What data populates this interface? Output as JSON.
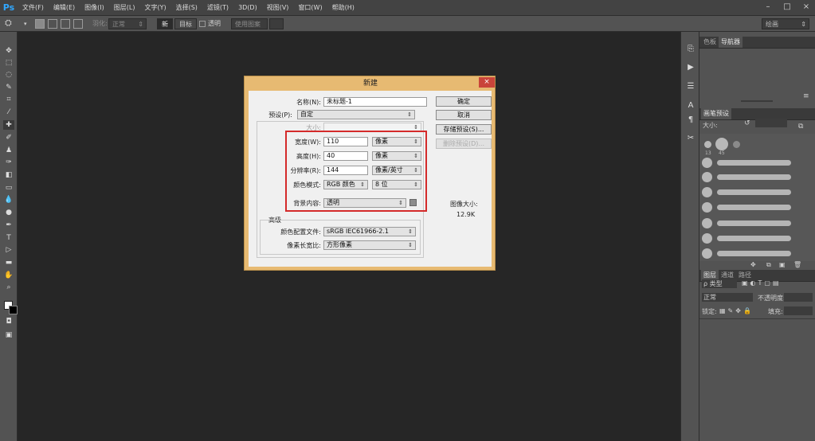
{
  "app": {
    "logo": "Ps"
  },
  "menu": [
    "文件(F)",
    "编辑(E)",
    "图像(I)",
    "图层(L)",
    "文字(Y)",
    "选择(S)",
    "滤镜(T)",
    "3D(D)",
    "视图(V)",
    "窗口(W)",
    "帮助(H)"
  ],
  "window_controls": {
    "minimize": "–",
    "restore": "□",
    "close": "×"
  },
  "options_bar": {
    "feather_label": "羽化:",
    "mode_label": "正常",
    "btn_new": "新",
    "btn_target": "目标",
    "transparent_label": "透明",
    "use_pattern": "使用图案",
    "workspace": "绘画"
  },
  "tools": [
    "move-icon",
    "marquee-icon",
    "lasso-icon",
    "quick-select-icon",
    "crop-icon",
    "eyedropper-icon",
    "healing-icon",
    "brush-icon",
    "stamp-icon",
    "history-brush-icon",
    "eraser-icon",
    "gradient-icon",
    "blur-icon",
    "dodge-icon",
    "pen-icon",
    "type-icon",
    "path-select-icon",
    "shape-icon",
    "hand-icon",
    "zoom-icon"
  ],
  "panels": {
    "top_tabs": [
      "色板",
      "导航器"
    ],
    "brush_presets_tab": "画笔预设",
    "brush_size_label": "大小:",
    "brush_sizes": [
      "13",
      "45"
    ],
    "layers_tabs": [
      "图层",
      "通道",
      "路径"
    ],
    "kind_label": "ρ 类型",
    "blend_mode": "正常",
    "opacity_label": "不透明度:",
    "lock_label": "锁定:",
    "fill_label": "填充:"
  },
  "dialog": {
    "title": "新建",
    "close": "×",
    "name_label": "名称(N):",
    "name_value": "未标题-1",
    "preset_label": "预设(P):",
    "preset_value": "自定",
    "size_label": "大小:",
    "width_label": "宽度(W):",
    "width_value": "110",
    "width_unit": "像素",
    "height_label": "高度(H):",
    "height_value": "40",
    "height_unit": "像素",
    "resolution_label": "分辨率(R):",
    "resolution_value": "144",
    "resolution_unit": "像素/英寸",
    "color_mode_label": "颜色模式:",
    "color_mode_value": "RGB 颜色",
    "bit_depth": "8 位",
    "background_label": "背景内容:",
    "background_value": "透明",
    "advanced_label": "高级",
    "color_profile_label": "颜色配置文件:",
    "color_profile_value": "sRGB IEC61966-2.1",
    "pixel_aspect_label": "像素长宽比:",
    "pixel_aspect_value": "方形像素",
    "ok_button": "确定",
    "cancel_button": "取消",
    "save_preset_button": "存储预设(S)...",
    "delete_preset_button": "删除预设(D)...",
    "image_size_label": "图像大小:",
    "image_size_value": "12.9K"
  }
}
